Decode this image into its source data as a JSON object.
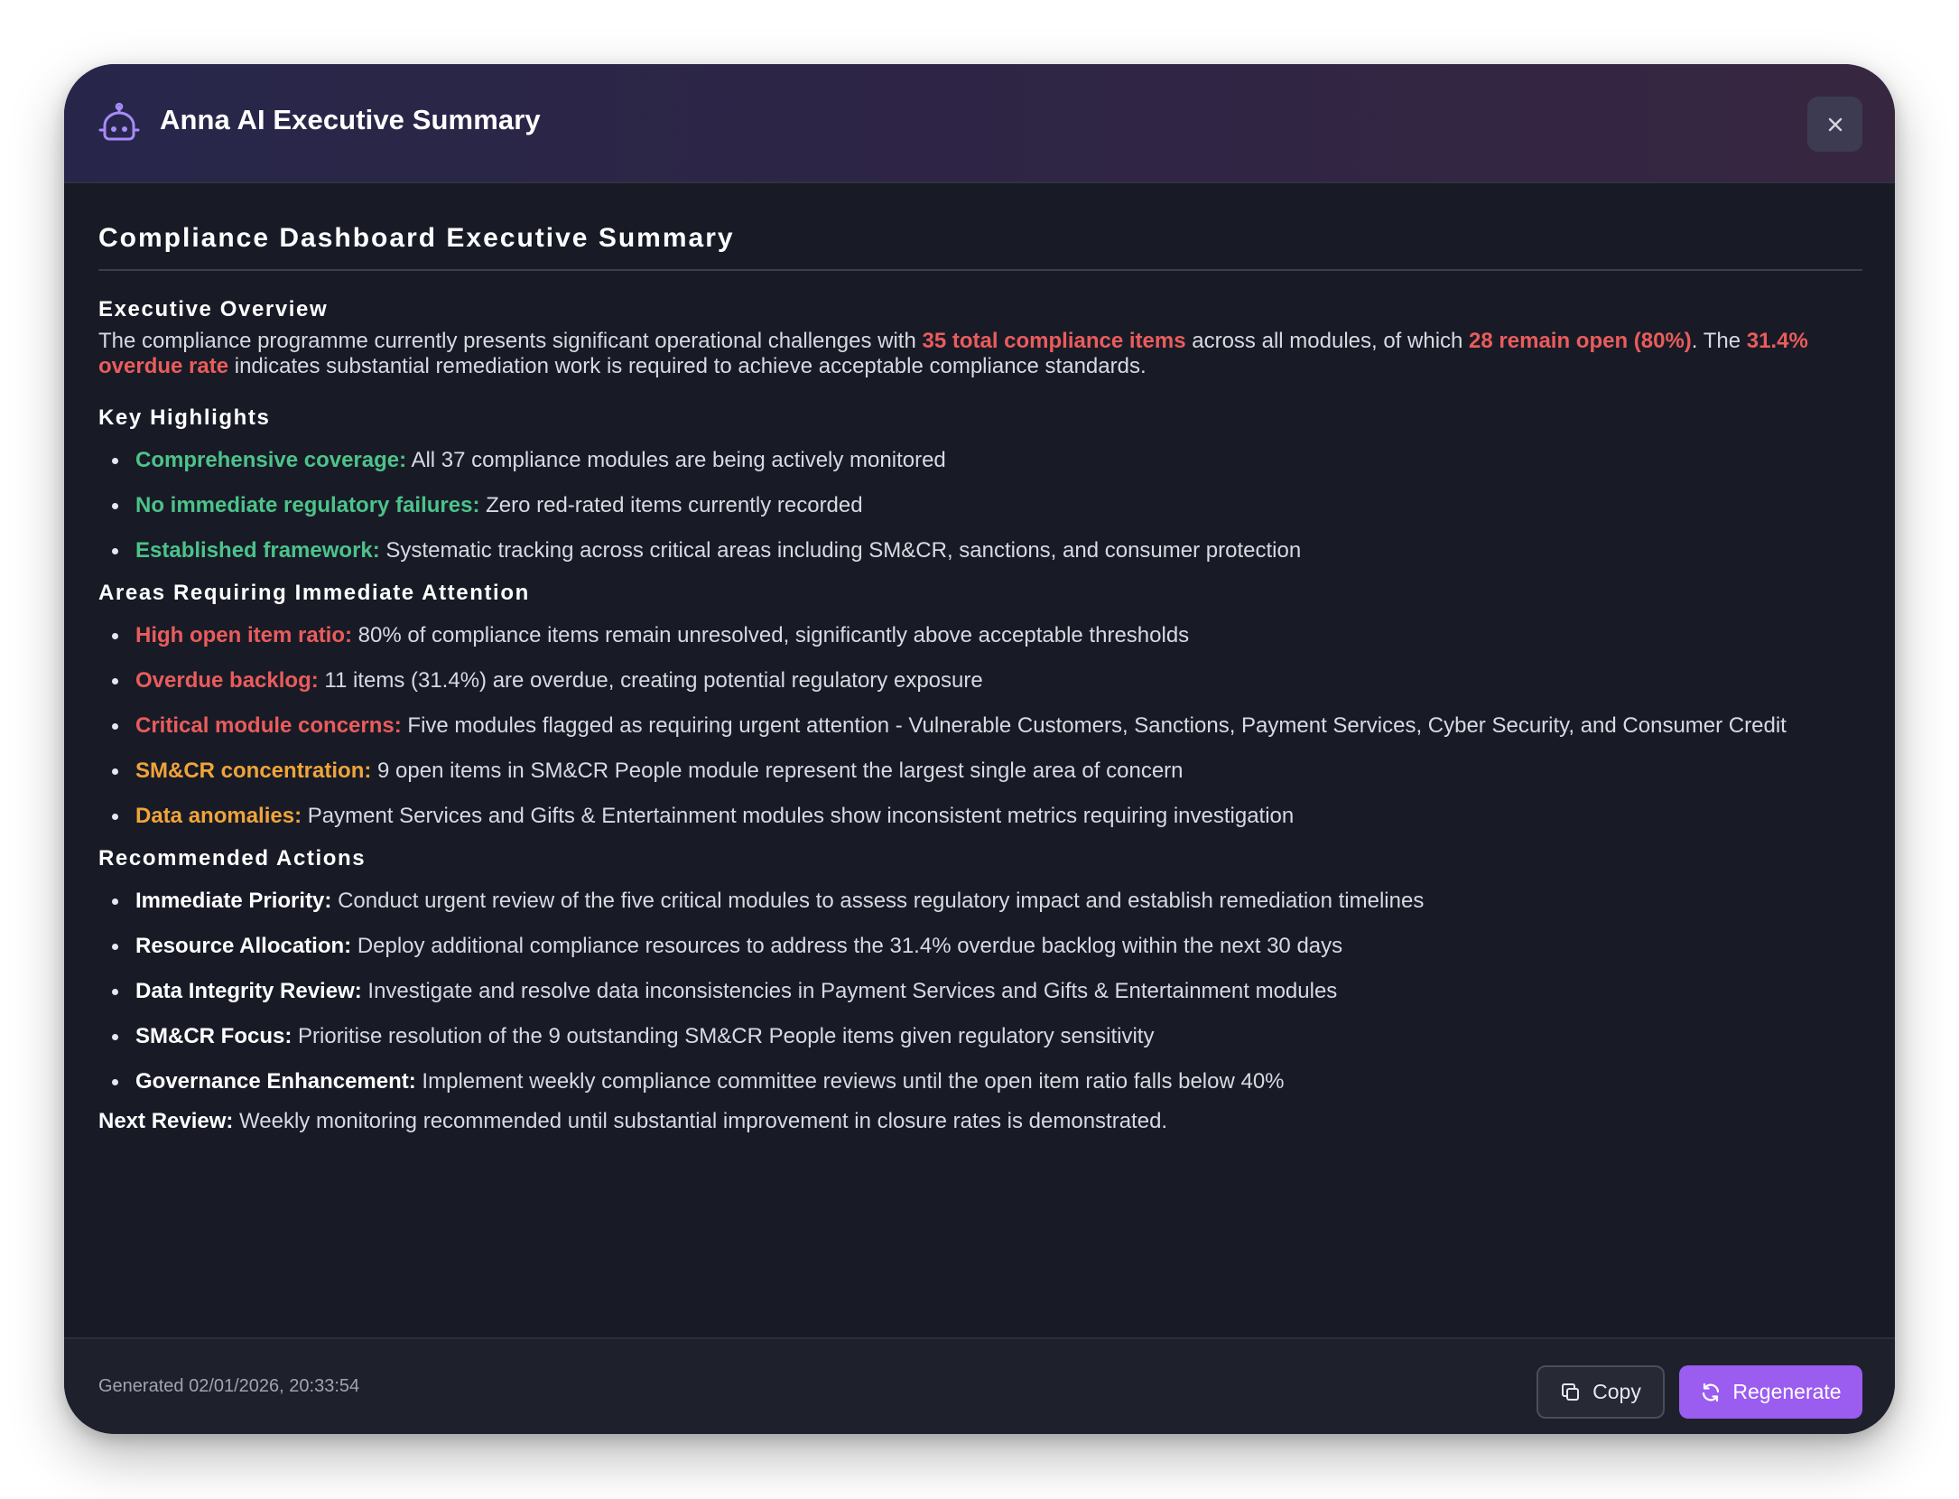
{
  "header": {
    "title": "Anna AI Executive Summary",
    "icon": "robot-icon",
    "close_icon": "close-icon",
    "accent_color": "#a78bfa"
  },
  "document": {
    "title": "Compliance Dashboard Executive Summary",
    "overview": {
      "heading": "Executive Overview",
      "text_1": "The compliance programme currently presents significant operational challenges with ",
      "hl_1": "35 total compliance items",
      "text_2": " across all modules, of which ",
      "hl_2": "28 remain open (80%)",
      "text_3": ". The ",
      "hl_3": "31.4% overdue rate",
      "text_4": " indicates substantial remediation work is required to achieve acceptable compliance standards."
    },
    "highlights": {
      "heading": "Key Highlights",
      "items": [
        {
          "label": "Comprehensive coverage:",
          "text": " All 37 compliance modules are being actively monitored"
        },
        {
          "label": "No immediate regulatory failures:",
          "text": " Zero red-rated items currently recorded"
        },
        {
          "label": "Established framework:",
          "text": " Systematic tracking across critical areas including SM&CR, sanctions, and consumer protection"
        }
      ]
    },
    "attention": {
      "heading": "Areas Requiring Immediate Attention",
      "items": [
        {
          "label": "High open item ratio:",
          "text": " 80% of compliance items remain unresolved, significantly above acceptable thresholds"
        },
        {
          "label": "Overdue backlog:",
          "text": " 11 items (31.4%) are overdue, creating potential regulatory exposure"
        },
        {
          "label": "Critical module concerns:",
          "text": " Five modules flagged as requiring urgent attention - Vulnerable Customers, Sanctions, Payment Services, Cyber Security, and Consumer Credit"
        },
        {
          "label": "SM&CR concentration:",
          "text": " 9 open items in SM&CR People module represent the largest single area of concern"
        },
        {
          "label": "Data anomalies:",
          "text": " Payment Services and Gifts & Entertainment modules show inconsistent metrics requiring investigation"
        }
      ]
    },
    "actions": {
      "heading": "Recommended Actions",
      "items": [
        {
          "label": "Immediate Priority:",
          "text": " Conduct urgent review of the five critical modules to assess regulatory impact and establish remediation timelines"
        },
        {
          "label": "Resource Allocation:",
          "text": " Deploy additional compliance resources to address the 31.4% overdue backlog within the next 30 days"
        },
        {
          "label": "Data Integrity Review:",
          "text": " Investigate and resolve data inconsistencies in Payment Services and Gifts & Entertainment modules"
        },
        {
          "label": "SM&CR Focus:",
          "text": " Prioritise resolution of the 9 outstanding SM&CR People items given regulatory sensitivity"
        },
        {
          "label": "Governance Enhancement:",
          "text": " Implement weekly compliance committee reviews until the open item ratio falls below 40%"
        }
      ]
    },
    "next_review": {
      "label": "Next Review:",
      "text": " Weekly monitoring recommended until substantial improvement in closure rates is demonstrated."
    }
  },
  "footer": {
    "generated": "Generated 02/01/2026, 20:33:54",
    "copy_label": "Copy",
    "copy_icon": "copy-icon",
    "regenerate_label": "Regenerate",
    "regenerate_icon": "refresh-icon"
  },
  "colors": {
    "positive": "#4cc38a",
    "critical": "#ea5c5c",
    "warning": "#f0a43a",
    "primary_button": "#9b5cf0"
  }
}
